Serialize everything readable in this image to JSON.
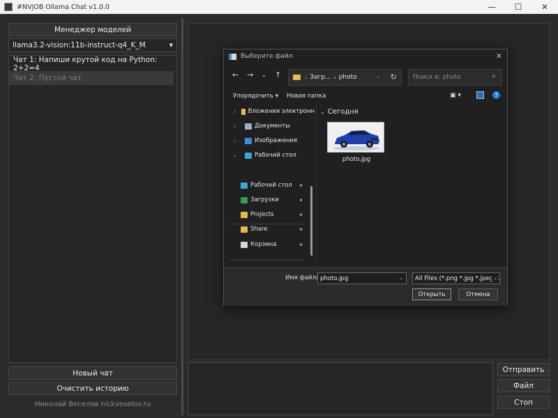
{
  "window": {
    "title": "#NVJOB Ollama Chat v1.0.0",
    "minimize": "—",
    "maximize": "☐",
    "close": "✕"
  },
  "left": {
    "model_manager_label": "Менеджер моделей",
    "selected_model": "llama3.2-vision:11b-instruct-q4_K_M",
    "chats": [
      {
        "label": "Чат 1: Напиши крутой код на Python: 2+2=4"
      },
      {
        "label": "Чат 2: Пустой чат"
      }
    ],
    "new_chat_label": "Новый чат",
    "clear_history_label": "Очистить историю",
    "credit": "Николай Веселов nickveselov.ru"
  },
  "right": {
    "send_label": "Отправить",
    "file_label": "Файл",
    "stop_label": "Стоп"
  },
  "dialog": {
    "title": "Выберите файл",
    "address_parent": "Загр...",
    "address_current": "photo",
    "search_placeholder": "Поиск в: photo",
    "organize_label": "Упорядочить ▾",
    "new_folder_label": "Новая папка",
    "nav_items": [
      {
        "label": "Вложения электронн",
        "icon": "folder-icon",
        "color": "#e6b94a"
      },
      {
        "label": "Документы",
        "icon": "documents-icon",
        "color": "#9ab0c8"
      },
      {
        "label": "Изображения",
        "icon": "pictures-icon",
        "color": "#3c8fd8"
      },
      {
        "label": "Рабочий стол",
        "icon": "desktop-icon",
        "color": "#3ba3e0"
      }
    ],
    "quick_access": [
      {
        "label": "Рабочий стол",
        "icon": "desktop-icon",
        "color": "#3ba3e0"
      },
      {
        "label": "Загрузки",
        "icon": "downloads-icon",
        "color": "#2ea44f"
      },
      {
        "label": "Projects",
        "icon": "folder-icon",
        "color": "#e6b94a"
      },
      {
        "label": "Share",
        "icon": "folder-icon",
        "color": "#e6b94a"
      },
      {
        "label": "Корзина",
        "icon": "recycle-bin-icon",
        "color": "#cfd6dd"
      }
    ],
    "group_label": "Сегодня",
    "file_name": "photo.jpg",
    "filename_label": "Имя файла:",
    "filename_value": "photo.jpg",
    "filter_value": "All Files (*.png *.jpg *.jpeg *.bmp",
    "open_label": "Открыть",
    "cancel_label": "Отмена"
  }
}
